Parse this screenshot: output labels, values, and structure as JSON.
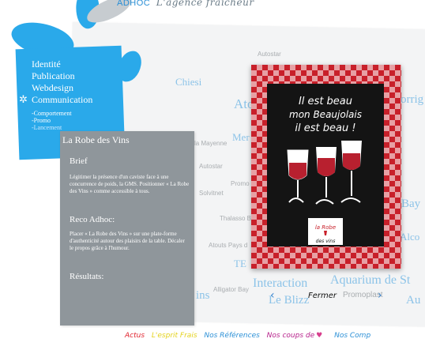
{
  "header": {
    "logo_text": "ADHOC",
    "tagline": "L'agence fraîcheur"
  },
  "menu": {
    "items": [
      "Identité",
      "Publication",
      "Webdesign",
      "Communication"
    ],
    "subitems": [
      "-Comportement",
      "-Promo",
      "-Lancement"
    ]
  },
  "background_words": {
    "autostar_top": "Autostar",
    "chiesi": "Chiesi",
    "ato": "Ato",
    "morri": "orrig",
    "mer": "Mer",
    "la_mayenne": "la Mayenne",
    "autostar_mid": "Autostar",
    "promo": "Promo",
    "solvitnet": "Solvitnet",
    "bay": "Bay",
    "thalasso": "Thalasso B",
    "alco": "Alco",
    "atouts": "Atouts Pays d",
    "te": "TE",
    "interaction": "Interaction",
    "aquarium": "Aquarium de St",
    "alligator": "Alligator Bay",
    "ins": "ins",
    "le_blizz": "Le Blizz",
    "promoplast": "Promoplast",
    "au": "Au"
  },
  "project": {
    "title": "La Robe des Vins",
    "brief_heading": "Brief",
    "brief_text": "Légitimer la présence d'un caviste face à une concurrence de poids, la GMS. Positionner « La Robe des Vins » comme accessible à tous.",
    "reco_heading": "Reco Adhoc:",
    "reco_text": "Placer « La Robe des Vins » sur une plate-forme d'authenticité autour des plaisirs de la table. Décaler le propos grâce à l'humour.",
    "results_heading": "Résultats:"
  },
  "poster": {
    "line1": "Il est beau",
    "line2": "mon Beaujolais",
    "line3": "il est beau !",
    "brand_top": "la Robe",
    "brand_bottom": "des vins",
    "colors": {
      "check": "#c8202a",
      "board": "#141414",
      "wine": "#b8202f"
    }
  },
  "viewer": {
    "close_label": "Fermer",
    "prev_symbol": "‹",
    "next_symbol": "›"
  },
  "footer": {
    "items": [
      {
        "label": "Actus",
        "color": "#e0212c"
      },
      {
        "label": "L'esprit Frais",
        "color": "#e4d21c"
      },
      {
        "label": "Nos Références",
        "color": "#2a8fd6"
      },
      {
        "label": "Nos coups de",
        "color": "#b61f8a"
      },
      {
        "label": "Nos Comp",
        "color": "#2a8fd6"
      }
    ]
  }
}
